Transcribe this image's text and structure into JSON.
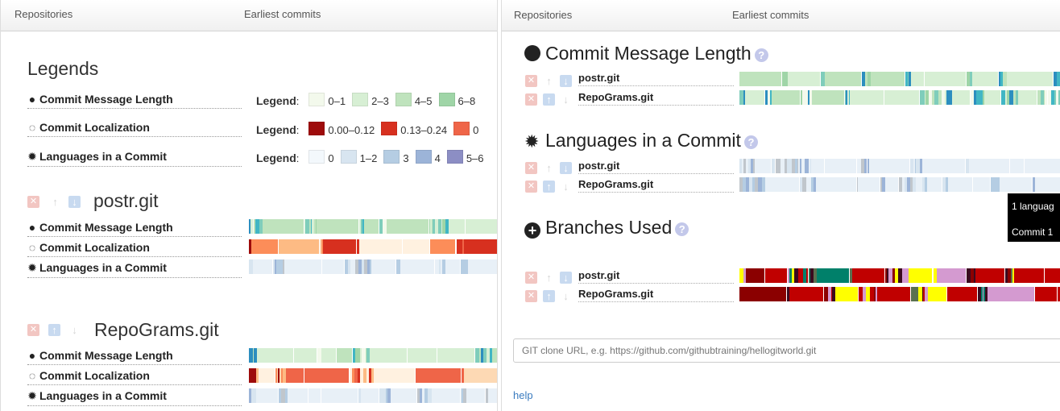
{
  "left_panel": {
    "nav": {
      "repositories": "Repositories",
      "earliest_commits": "Earliest commits"
    },
    "legends_title": "Legends",
    "metrics": [
      {
        "icon": "filled-circle-icon",
        "glyph": "●",
        "label": "Commit Message Length"
      },
      {
        "icon": "dotted-circle-icon",
        "glyph": "◌",
        "label": "Commit Localization"
      },
      {
        "icon": "badge-icon",
        "glyph": "✹",
        "label": "Languages in a Commit"
      }
    ],
    "legends": [
      {
        "word": "Legend",
        "items": [
          {
            "color": "#f3f9ec",
            "label": "0–1"
          },
          {
            "color": "#d7efd4",
            "label": "2–3"
          },
          {
            "color": "#bfe3bd",
            "label": "4–5"
          },
          {
            "color": "#9fd5a7",
            "label": "6–8"
          }
        ]
      },
      {
        "word": "Legend",
        "items": [
          {
            "color": "#9e0b0b",
            "label": "0.00–0.12"
          },
          {
            "color": "#d7301f",
            "label": "0.13–0.24"
          },
          {
            "color": "#ef6548",
            "label": "0"
          }
        ]
      },
      {
        "word": "Legend",
        "items": [
          {
            "color": "#f3f8fc",
            "label": "0"
          },
          {
            "color": "#d8e5f0",
            "label": "1–2"
          },
          {
            "color": "#b5cde3",
            "label": "3"
          },
          {
            "color": "#9cb4d8",
            "label": "4"
          },
          {
            "color": "#8c8ec4",
            "label": "5–6"
          }
        ]
      }
    ],
    "repos": [
      {
        "name": "postr.git"
      },
      {
        "name": "RepoGrams.git"
      }
    ]
  },
  "right_panel": {
    "nav": {
      "repositories": "Repositories",
      "earliest_commits": "Earliest commits"
    },
    "sections": [
      {
        "icon": "filled-circle-icon",
        "title": "Commit Message Length",
        "help": "?"
      },
      {
        "icon": "badge-icon",
        "title": "Languages in a Commit",
        "help": "?"
      },
      {
        "icon": "plus-circle-icon",
        "title": "Branches Used",
        "help": "?"
      }
    ],
    "repo_labels": [
      "postr.git",
      "RepoGrams.git"
    ],
    "tooltip": {
      "line1": "1 languag",
      "line2": "Commit 1"
    },
    "input": {
      "placeholder": "GIT clone URL, e.g. https://github.com/githubtraining/hellogitworld.git"
    },
    "help_link": "help"
  },
  "colors": {
    "msg": [
      "#f3f9ec",
      "#d7efd4",
      "#bfe3bd",
      "#9fd5a7",
      "#7fcdbb",
      "#41b6c4",
      "#2c8ebf"
    ],
    "loc": [
      "#9e0b0b",
      "#d7301f",
      "#ef6548",
      "#fc8d59",
      "#fdbb84",
      "#fdd9b4",
      "#fff1e0"
    ],
    "lang": [
      "#e8f0f7",
      "#d8e5f0",
      "#b5cde3",
      "#9cb4d8",
      "#c0c6cc"
    ],
    "branch": [
      "#c00000",
      "#ffff00",
      "#3b0a1f",
      "#00806a",
      "#d49ad0",
      "#8b0000",
      "#5a7050"
    ]
  }
}
